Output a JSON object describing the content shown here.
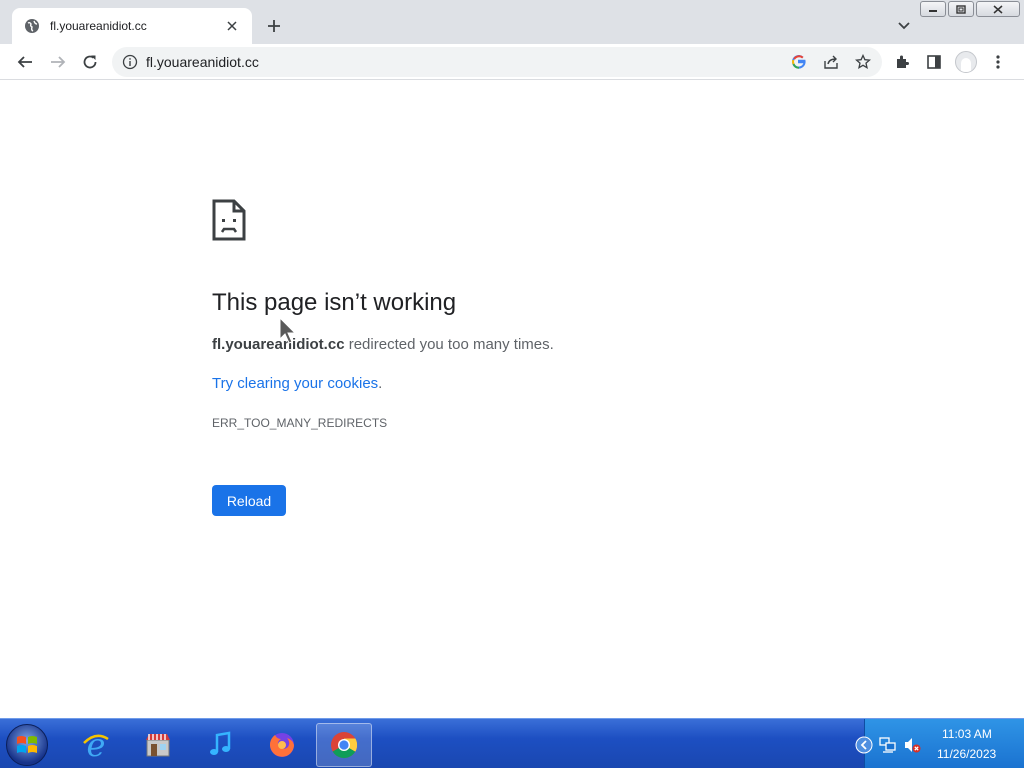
{
  "browser": {
    "tab": {
      "title": "fl.youareanidiot.cc",
      "favicon": "globe-icon"
    },
    "url": "fl.youareanidiot.cc",
    "toolbar_icons": [
      "back-icon",
      "forward-icon",
      "reload-icon",
      "site-info-icon",
      "google-lens-icon",
      "share-icon",
      "bookmark-star-icon",
      "extensions-icon",
      "side-panel-icon",
      "profile-avatar",
      "menu-icon"
    ]
  },
  "error_page": {
    "icon": "sad-document-icon",
    "heading": "This page isn’t working",
    "domain": "fl.youareanidiot.cc",
    "detail_rest": " redirected you too many times.",
    "suggestion_link": "Try clearing your cookies",
    "suggestion_end": ".",
    "error_code": "ERR_TOO_MANY_REDIRECTS",
    "reload_label": "Reload"
  },
  "taskbar": {
    "apps": [
      "internet-explorer-icon",
      "store-icon",
      "music-icon",
      "firefox-icon",
      "chrome-icon"
    ],
    "active_app": "chrome-icon",
    "clock_time": "11:03 AM",
    "clock_date": "11/26/2023"
  },
  "colors": {
    "accent": "#1a73e8",
    "taskbar": "#1d4fc2",
    "tray": "#2187dc"
  }
}
